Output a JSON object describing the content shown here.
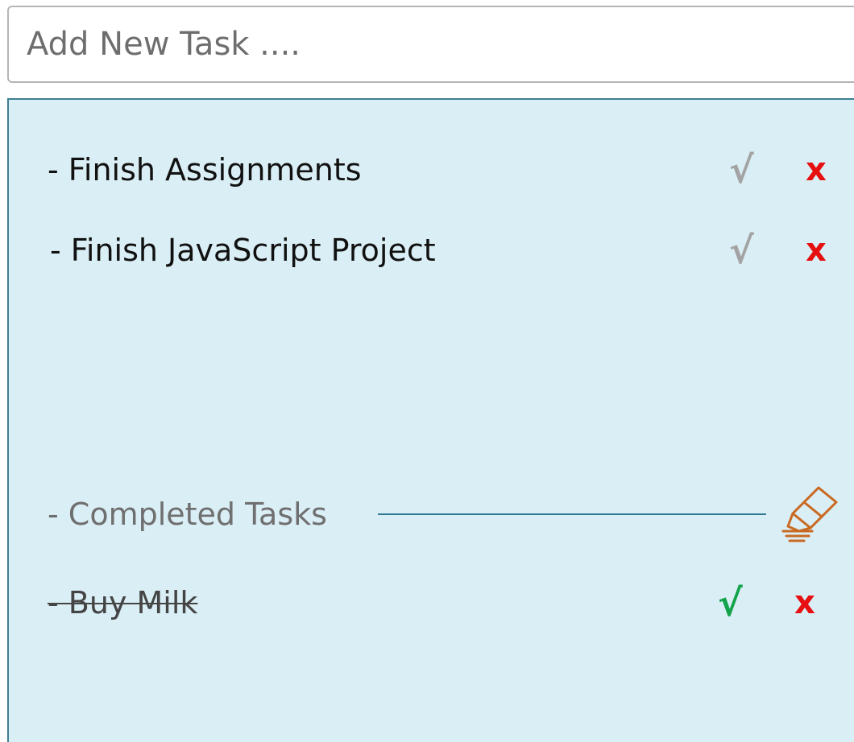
{
  "new_task": {
    "placeholder": "Add New Task ...."
  },
  "active_tasks": [
    {
      "label": "- Finish Assignments",
      "complete_icon": "√",
      "delete_icon": "x"
    },
    {
      "label": "- Finish JavaScript Project",
      "complete_icon": "√",
      "delete_icon": "x"
    }
  ],
  "completed_section": {
    "title": "- Completed Tasks",
    "clear_icon": "eraser-icon",
    "tasks": [
      {
        "label": "- Buy Milk",
        "complete_icon": "√",
        "delete_icon": "x"
      }
    ]
  },
  "colors": {
    "panel_bg": "#daeef5",
    "panel_border": "#3e7f93",
    "check_pending": "#a3a3a3",
    "check_done": "#12a34a",
    "delete": "#e61010",
    "eraser": "#c96a22"
  }
}
